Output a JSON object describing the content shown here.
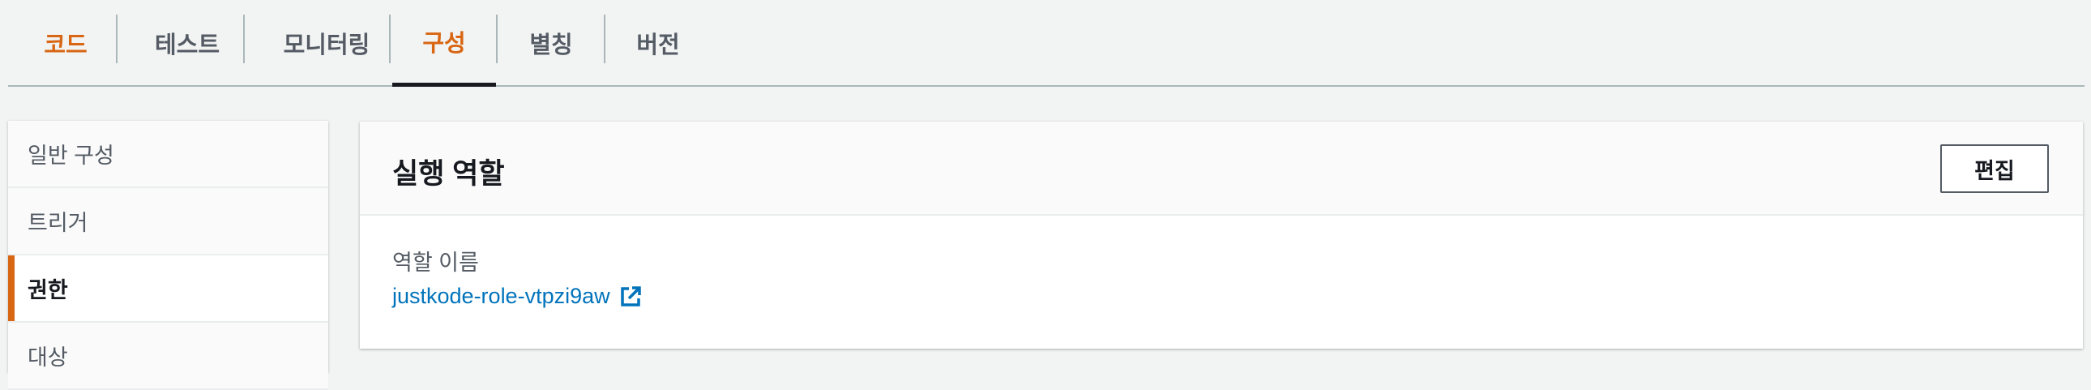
{
  "tabs": [
    {
      "label": "코드",
      "active": true
    },
    {
      "label": "테스트"
    },
    {
      "label": "모니터링"
    },
    {
      "label": "구성",
      "selected": true
    },
    {
      "label": "별칭"
    },
    {
      "label": "버전"
    }
  ],
  "side_nav": {
    "items": [
      {
        "label": "일반 구성"
      },
      {
        "label": "트리거"
      },
      {
        "label": "권한",
        "active": true
      },
      {
        "label": "대상"
      }
    ]
  },
  "panel": {
    "title": "실행 역할",
    "edit_label": "편집",
    "role_name_label": "역할 이름",
    "role_name": "justkode-role-vtpzi9aw",
    "link_icon": "external-link-icon"
  },
  "colors": {
    "accent_orange": "#d86613",
    "link_blue": "#0073bb",
    "text_dark": "#16191f",
    "text_muted": "#545b64",
    "background": "#f2f3f3"
  }
}
